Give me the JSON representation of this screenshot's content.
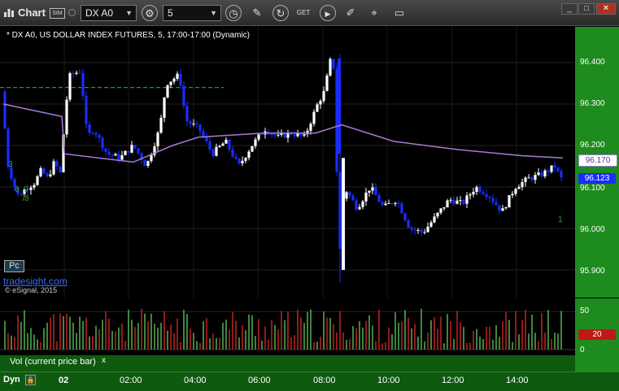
{
  "toolbar": {
    "title": "Chart",
    "sim_badge": "SIM",
    "symbol": "DX A0",
    "interval": "5",
    "icons": [
      "symbol-settings-icon",
      "time-icon",
      "draw-pencil-icon",
      "refresh-icon",
      "get-data-icon",
      "play-icon",
      "edit-icon",
      "tag-icon",
      "message-icon"
    ],
    "window_buttons": [
      "minimize",
      "maximize",
      "close"
    ]
  },
  "chart": {
    "header": "* DX A0, US DOLLAR INDEX FUTURES, 5, 17:00-17:00 (Dynamic)",
    "pc_badge": "Pc",
    "watermark": "tradesight.com",
    "copyright": "© eSignal, 2015",
    "price_ticks": [
      "96.400",
      "96.300",
      "96.200",
      "96.100",
      "96.000",
      "95.900"
    ],
    "last_price": "96.123",
    "ma_price": "96.170",
    "colors": {
      "up": "#ffffff",
      "down": "#1a2cff",
      "ma": "#a77ad8",
      "dashed": "#00aa33",
      "vol_up": "#4fa64f",
      "vol_down": "#b82020",
      "axis_bg": "#1e8b1e"
    },
    "annotations": [
      "3",
      "6",
      "9",
      "7",
      "8",
      "1"
    ]
  },
  "volume": {
    "label": "Vol (current price bar)",
    "close": "x",
    "ticks": [
      "50",
      "20",
      "0"
    ],
    "current": "20"
  },
  "time_axis": {
    "mode": "Dyn",
    "labels": [
      "02",
      "02:00",
      "04:00",
      "06:00",
      "08:00",
      "10:00",
      "12:00",
      "14:00"
    ]
  },
  "chart_data": {
    "type": "candlestick",
    "title": "* DX A0, US DOLLAR INDEX FUTURES, 5, 17:00-17:00 (Dynamic)",
    "y_range": [
      95.85,
      96.45
    ],
    "close_path": [
      [
        0.0,
        96.33
      ],
      [
        0.05,
        96.15
      ],
      [
        0.12,
        96.08
      ],
      [
        0.2,
        96.1
      ],
      [
        0.25,
        96.11
      ],
      [
        0.3,
        96.14
      ],
      [
        0.35,
        96.12
      ],
      [
        0.4,
        96.16
      ],
      [
        0.45,
        96.13
      ],
      [
        0.48,
        96.28
      ],
      [
        0.52,
        96.37
      ],
      [
        0.6,
        96.38
      ],
      [
        0.65,
        96.22
      ],
      [
        0.7,
        96.24
      ],
      [
        0.8,
        96.18
      ],
      [
        0.9,
        96.17
      ],
      [
        1.0,
        96.2
      ],
      [
        1.1,
        96.15
      ],
      [
        1.2,
        96.24
      ],
      [
        1.25,
        96.35
      ],
      [
        1.35,
        96.37
      ],
      [
        1.4,
        96.26
      ],
      [
        1.5,
        96.24
      ],
      [
        1.6,
        96.18
      ],
      [
        1.7,
        96.21
      ],
      [
        1.8,
        96.15
      ],
      [
        1.9,
        96.2
      ],
      [
        2.0,
        96.24
      ],
      [
        2.1,
        96.22
      ],
      [
        2.2,
        96.23
      ],
      [
        2.3,
        96.22
      ],
      [
        2.4,
        96.3
      ],
      [
        2.45,
        96.33
      ],
      [
        2.5,
        96.41
      ],
      [
        2.53,
        96.38
      ],
      [
        2.56,
        95.9
      ],
      [
        2.6,
        96.1
      ],
      [
        2.7,
        96.05
      ],
      [
        2.8,
        96.1
      ],
      [
        2.9,
        96.05
      ],
      [
        3.0,
        96.07
      ],
      [
        3.1,
        96.0
      ],
      [
        3.2,
        95.99
      ],
      [
        3.3,
        96.03
      ],
      [
        3.4,
        96.07
      ],
      [
        3.5,
        96.06
      ],
      [
        3.6,
        96.1
      ],
      [
        3.7,
        96.08
      ],
      [
        3.8,
        96.04
      ],
      [
        3.9,
        96.1
      ],
      [
        4.0,
        96.12
      ],
      [
        4.1,
        96.13
      ],
      [
        4.2,
        96.15
      ],
      [
        4.25,
        96.12
      ]
    ],
    "ma_path": [
      [
        0.0,
        96.3
      ],
      [
        0.45,
        96.27
      ],
      [
        0.47,
        96.18
      ],
      [
        1.0,
        96.16
      ],
      [
        1.3,
        96.2
      ],
      [
        1.5,
        96.22
      ],
      [
        2.0,
        96.23
      ],
      [
        2.4,
        96.23
      ],
      [
        2.6,
        96.25
      ],
      [
        3.0,
        96.21
      ],
      [
        3.5,
        96.19
      ],
      [
        4.0,
        96.175
      ],
      [
        4.3,
        96.17
      ]
    ],
    "dashed_line": 96.34,
    "x_labels": [
      "02",
      "02:00",
      "04:00",
      "06:00",
      "08:00",
      "10:00",
      "12:00",
      "14:00"
    ],
    "volume_ylim": [
      0,
      60
    ]
  }
}
